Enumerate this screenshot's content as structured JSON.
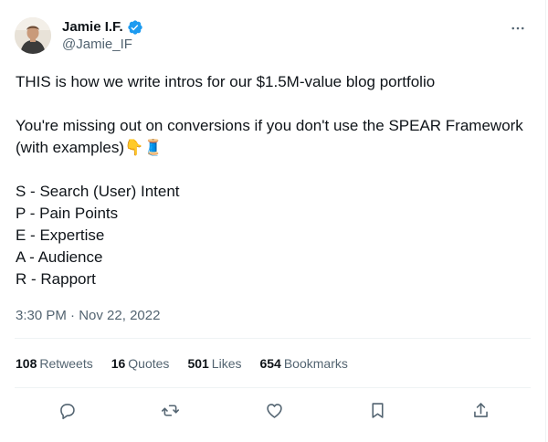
{
  "author": {
    "display_name": "Jamie I.F.",
    "handle": "@Jamie_IF",
    "verified": true,
    "verified_color": "#1d9bf0"
  },
  "tweet": {
    "lines": [
      "THIS is how we write intros for our $1.5M-value blog portfolio",
      "",
      "You're missing out on conversions if you don't use the SPEAR Framework",
      "(with examples)👇🧵",
      "",
      "S - Search (User) Intent",
      "P - Pain Points",
      "E - Expertise",
      "A - Audience",
      "R - Rapport"
    ],
    "time": "3:30 PM",
    "separator": " · ",
    "date": "Nov 22, 2022"
  },
  "stats": {
    "retweets": {
      "count": "108",
      "label": "Retweets"
    },
    "quotes": {
      "count": "16",
      "label": "Quotes"
    },
    "likes": {
      "count": "501",
      "label": "Likes"
    },
    "bookmarks": {
      "count": "654",
      "label": "Bookmarks"
    }
  },
  "icons": {
    "more": "more-icon",
    "reply": "reply-icon",
    "retweet": "retweet-icon",
    "like": "like-icon",
    "bookmark": "bookmark-icon",
    "share": "share-icon"
  },
  "colors": {
    "text": "#0f1419",
    "secondary": "#536471",
    "divider": "#eff3f4"
  }
}
